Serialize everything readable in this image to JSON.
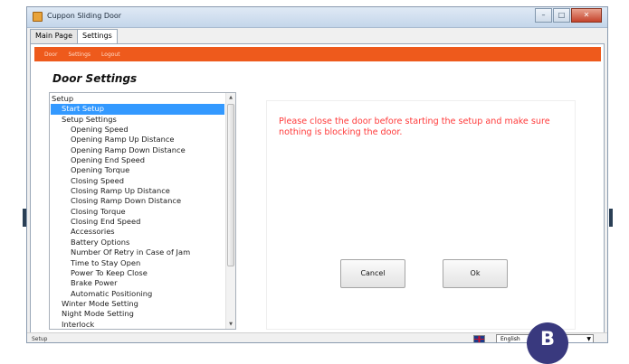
{
  "window": {
    "title": "Cuppon Sliding Door",
    "controls": {
      "minimize": "–",
      "maximize": "□",
      "close": "✕"
    }
  },
  "tabs": [
    {
      "label": "Main Page",
      "active": false
    },
    {
      "label": "Settings",
      "active": true
    }
  ],
  "menubar": {
    "background": "#ee5a1c",
    "items": [
      "Door",
      "Settings",
      "Logout"
    ]
  },
  "section": {
    "title": "Door Settings"
  },
  "tree": {
    "items": [
      {
        "label": "Setup",
        "level": 0
      },
      {
        "label": "Start Setup",
        "level": 1,
        "selected": true
      },
      {
        "label": "Setup Settings",
        "level": 1
      },
      {
        "label": "Opening Speed",
        "level": 2
      },
      {
        "label": "Opening Ramp Up Distance",
        "level": 2
      },
      {
        "label": "Opening Ramp Down Distance",
        "level": 2
      },
      {
        "label": "Opening End Speed",
        "level": 2
      },
      {
        "label": "Opening Torque",
        "level": 2
      },
      {
        "label": "Closing Speed",
        "level": 2
      },
      {
        "label": "Closing Ramp Up Distance",
        "level": 2
      },
      {
        "label": "Closing Ramp Down Distance",
        "level": 2
      },
      {
        "label": "Closing Torque",
        "level": 2
      },
      {
        "label": "Closing End Speed",
        "level": 2
      },
      {
        "label": "Accessories",
        "level": 2
      },
      {
        "label": "Battery Options",
        "level": 2
      },
      {
        "label": "Number Of Retry in Case of Jam",
        "level": 2
      },
      {
        "label": "Time to Stay Open",
        "level": 2
      },
      {
        "label": "Power To Keep Close",
        "level": 2
      },
      {
        "label": "Brake Power",
        "level": 2
      },
      {
        "label": "Automatic Positioning",
        "level": 2
      },
      {
        "label": "Winter Mode Setting",
        "level": 1
      },
      {
        "label": "Night Mode Setting",
        "level": 1
      },
      {
        "label": "Interlock",
        "level": 1
      }
    ],
    "scroll_up_icon": "triangle-up",
    "scroll_down_icon": "triangle-down"
  },
  "panel": {
    "message": "Please close the door before starting the setup and make sure nothing is blocking the door.",
    "message_color": "#ff3a3a",
    "cancel_label": "Cancel",
    "ok_label": "Ok"
  },
  "statusbar": {
    "status": "Setup",
    "language": "English",
    "language_icon": "uk-flag"
  },
  "badge": {
    "label": "B",
    "color": "#39397e"
  }
}
